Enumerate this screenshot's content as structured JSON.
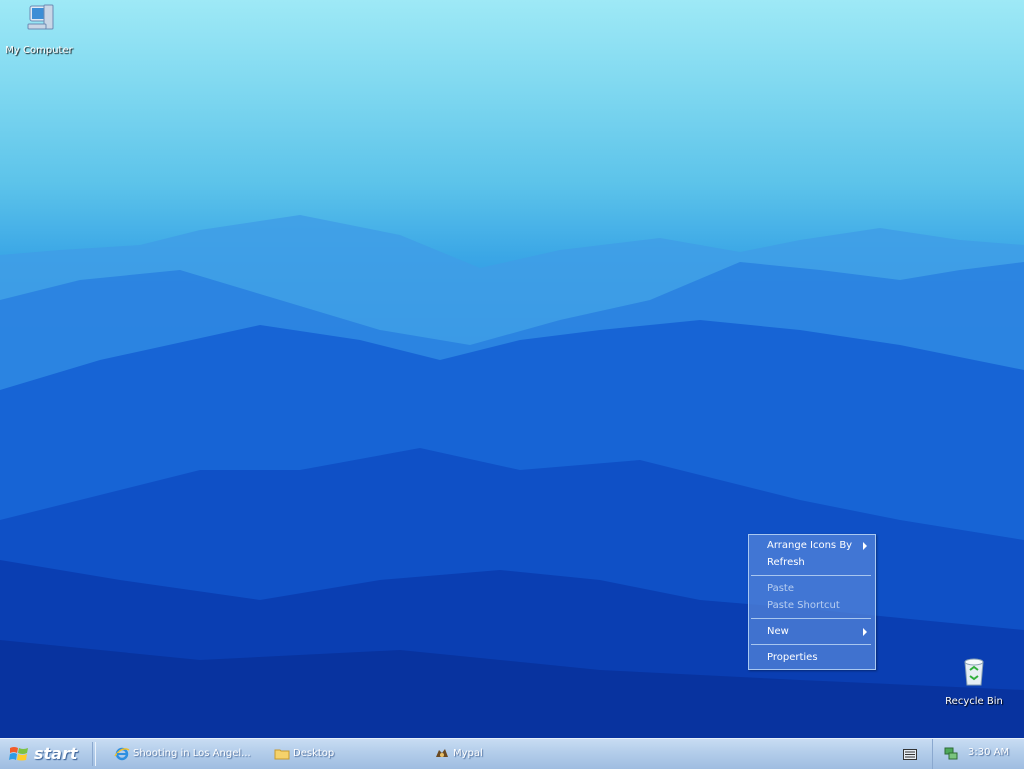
{
  "desktop": {
    "icons": [
      {
        "label": "My Computer",
        "icon": "my-computer-icon"
      },
      {
        "label": "Recycle Bin",
        "icon": "recycle-bin-icon"
      }
    ]
  },
  "context_menu": {
    "items": [
      {
        "label": "Arrange Icons By",
        "enabled": true,
        "submenu": true
      },
      {
        "label": "Refresh",
        "enabled": true,
        "submenu": false
      },
      {
        "label": "Paste",
        "enabled": false,
        "submenu": false
      },
      {
        "label": "Paste Shortcut",
        "enabled": false,
        "submenu": false
      },
      {
        "label": "New",
        "enabled": true,
        "submenu": true
      },
      {
        "label": "Properties",
        "enabled": true,
        "submenu": false
      }
    ]
  },
  "taskbar": {
    "start_label": "start",
    "tasks": [
      {
        "label": "Shooting in Los Angel...",
        "icon": "internet-explorer-icon"
      },
      {
        "label": "Desktop",
        "icon": "folder-icon"
      },
      {
        "label": "Mypal",
        "icon": "mypal-browser-icon"
      }
    ],
    "tray": {
      "clock": "3:30 AM",
      "icons": [
        "keyboard-icon",
        "network-icon"
      ]
    }
  },
  "colors": {
    "taskbar": "#b3cdea",
    "menu": "#5082d7",
    "sky": "#9ee9f6",
    "mountains_dark": "#08329e"
  }
}
